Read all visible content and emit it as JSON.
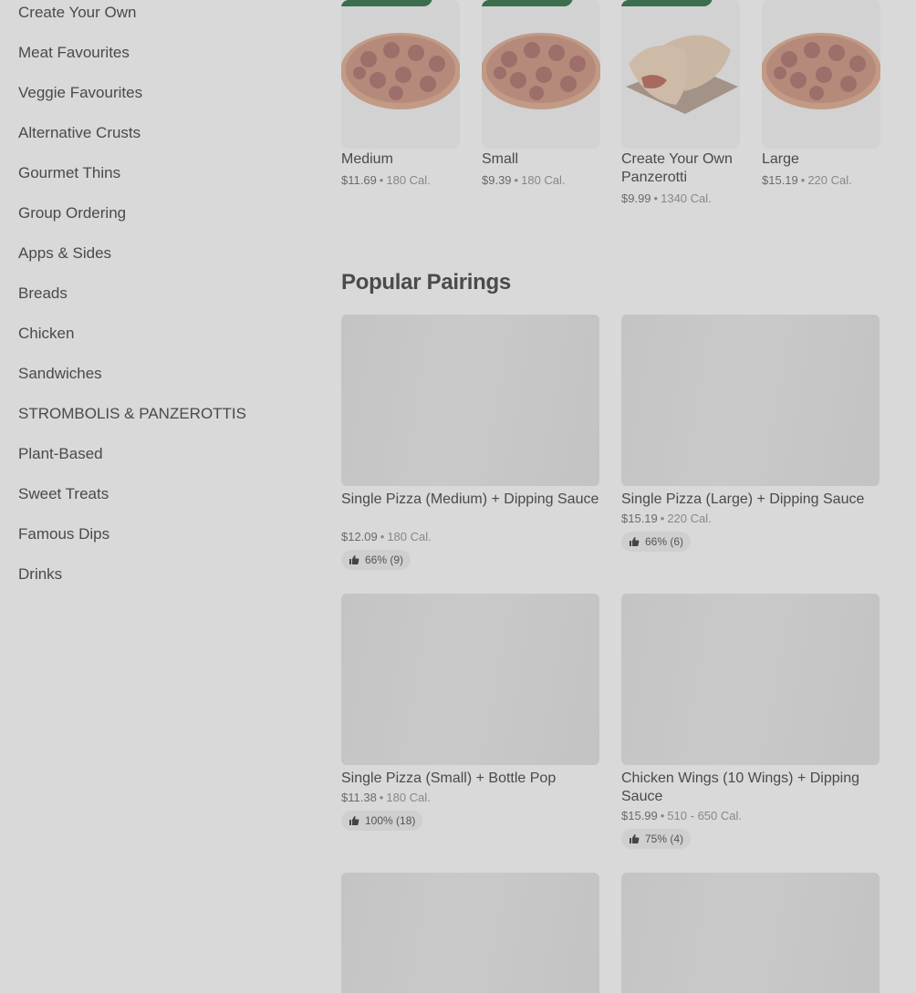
{
  "sidebar": {
    "items": [
      {
        "label": "Create Your Own"
      },
      {
        "label": "Meat Favourites"
      },
      {
        "label": "Veggie Favourites"
      },
      {
        "label": "Alternative Crusts"
      },
      {
        "label": "Gourmet Thins"
      },
      {
        "label": "Group Ordering"
      },
      {
        "label": "Apps & Sides"
      },
      {
        "label": "Breads"
      },
      {
        "label": "Chicken"
      },
      {
        "label": "Sandwiches"
      },
      {
        "label": "STROMBOLIS & PANZEROTTIS"
      },
      {
        "label": "Plant-Based"
      },
      {
        "label": "Sweet Treats"
      },
      {
        "label": "Famous Dips"
      },
      {
        "label": "Drinks"
      }
    ]
  },
  "top_items": [
    {
      "title": "Medium",
      "price": "$11.69",
      "calories": "180 Cal.",
      "image_icon": "pizza"
    },
    {
      "title": "Small",
      "price": "$9.39",
      "calories": "180 Cal.",
      "image_icon": "pizza"
    },
    {
      "title": "Create Your Own Panzerotti",
      "title_line1": "Create Your Own",
      "title_line2": "Panzerotti",
      "price": "$9.99",
      "calories": "1340 Cal.",
      "image_icon": "panzerotti"
    },
    {
      "title": "Large",
      "price": "$15.19",
      "calories": "220 Cal.",
      "image_icon": "pizza"
    }
  ],
  "popular_pairings": {
    "title": "Popular Pairings",
    "items": [
      {
        "title": "Single Pizza (Medium) + Dipping Sauce",
        "price": "$12.09",
        "calories": "180 Cal.",
        "rating": "66% (9)"
      },
      {
        "title": "Single Pizza (Large) + Dipping Sauce",
        "price": "$15.19",
        "calories": "220 Cal.",
        "rating": "66% (6)"
      },
      {
        "title": "Single Pizza (Small) + Bottle Pop",
        "price": "$11.38",
        "calories": "180 Cal.",
        "rating": "100% (18)"
      },
      {
        "title": "Chicken Wings (10 Wings) + Dipping Sauce",
        "price": "$15.99",
        "calories": "510 - 650 Cal.",
        "rating": "75% (4)"
      }
    ]
  },
  "colors": {
    "background": "#d9d9d9",
    "badge": "#3b6e4c",
    "text": "#4a4a4a"
  }
}
